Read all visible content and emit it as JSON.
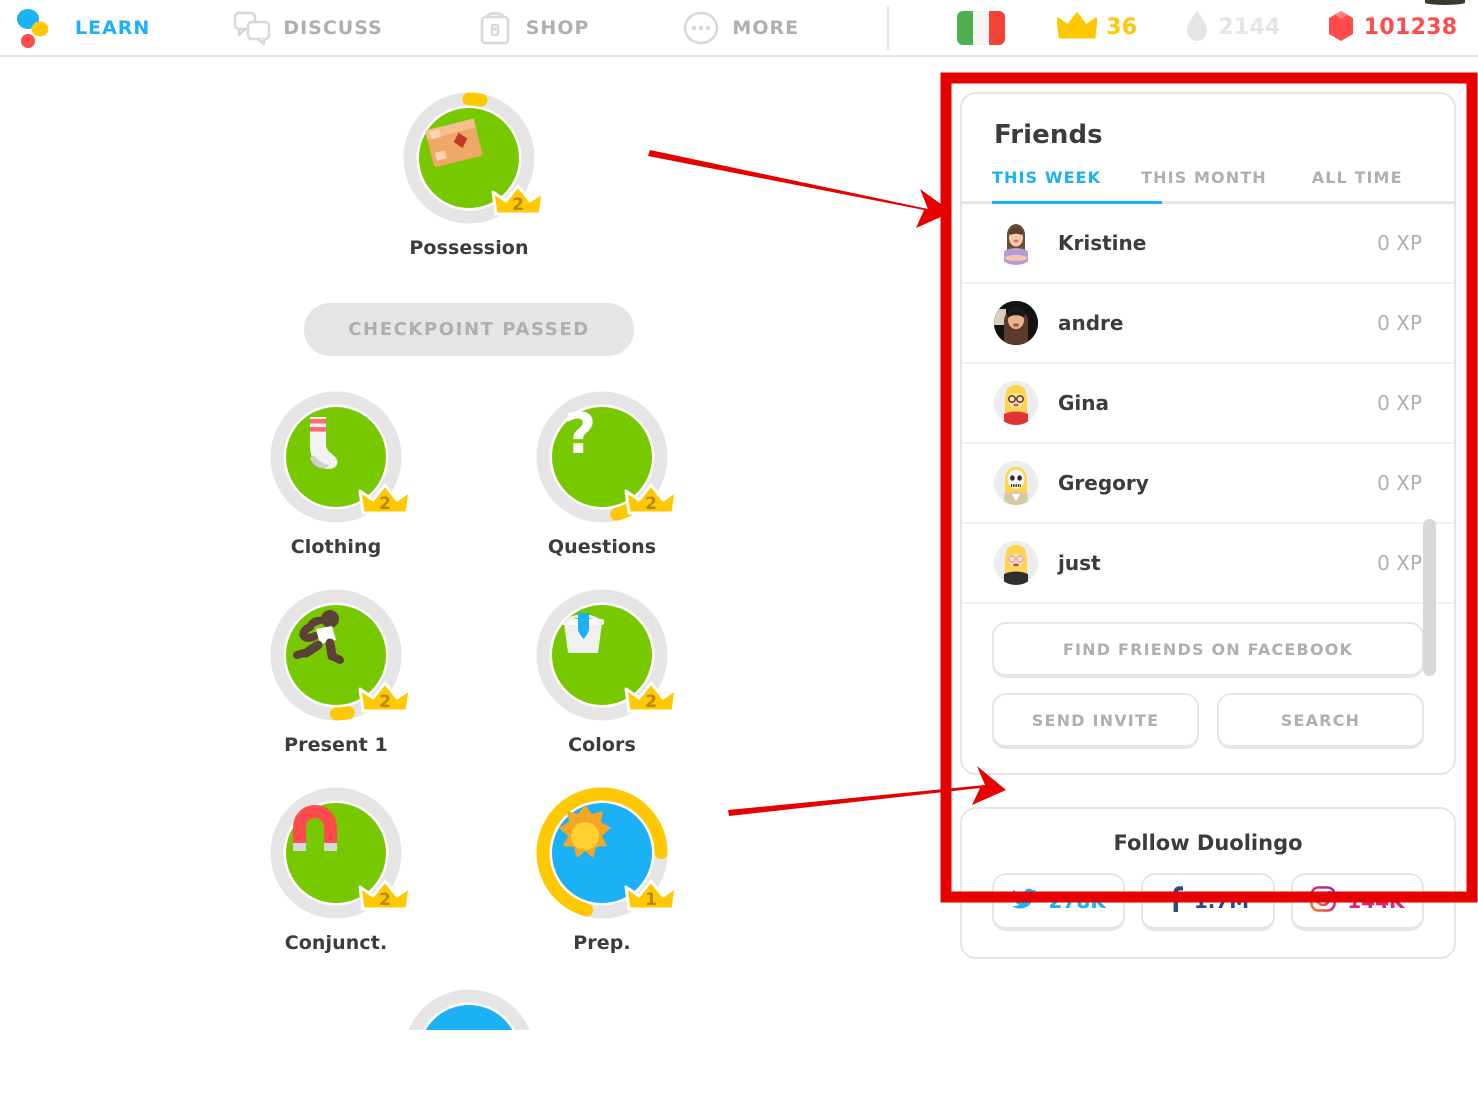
{
  "nav": {
    "items": [
      {
        "label": "LEARN",
        "icon": "duolingo-logo-icon",
        "active": true
      },
      {
        "label": "DISCUSS",
        "icon": "speech-bubbles-icon",
        "active": false
      },
      {
        "label": "SHOP",
        "icon": "shop-bag-icon",
        "active": false
      },
      {
        "label": "MORE",
        "icon": "ellipsis-circle-icon",
        "active": false
      }
    ]
  },
  "stats": {
    "flag": {
      "name": "italian-flag-icon",
      "alt": "Italian"
    },
    "crown": {
      "icon": "crown-icon",
      "value": "36",
      "color": "#ffc800"
    },
    "streak": {
      "icon": "streak-flame-icon",
      "value": "2144",
      "color": "#e5e5e5"
    },
    "gems": {
      "icon": "gem-icon",
      "value": "101238",
      "color": "#ff4b4b"
    }
  },
  "tree": {
    "checkpoint_label": "CHECKPOINT PASSED",
    "rows": [
      [
        {
          "name": "Possession",
          "icon": "package-box-icon",
          "bubble": "green",
          "crown": "2",
          "progress": 0.97
        }
      ],
      [
        {
          "name": "Clothing",
          "icon": "sock-icon",
          "bubble": "green",
          "crown": "2",
          "progress": 0.97
        },
        {
          "name": "Questions",
          "icon": "question-mark-icon",
          "bubble": "green",
          "crown": "2",
          "progress": 0.95
        }
      ],
      [
        {
          "name": "Present 1",
          "icon": "running-person-icon",
          "bubble": "green",
          "crown": "2",
          "progress": 0.96
        },
        {
          "name": "Colors",
          "icon": "paint-bucket-icon",
          "bubble": "green",
          "crown": "2",
          "progress": 1.0
        }
      ],
      [
        {
          "name": "Conjunct.",
          "icon": "magnet-icon",
          "bubble": "green",
          "crown": "2",
          "progress": 1.0
        },
        {
          "name": "Prep.",
          "icon": "sun-icon",
          "bubble": "blue",
          "crown": "1",
          "progress": 0.72
        }
      ]
    ]
  },
  "friends": {
    "title": "Friends",
    "tabs": [
      {
        "label": "THIS WEEK",
        "active": true
      },
      {
        "label": "THIS MONTH",
        "active": false
      },
      {
        "label": "ALL TIME",
        "active": false
      }
    ],
    "rows": [
      {
        "name": "Kristine",
        "xp": "0 XP",
        "avatar": "avatar-kristine"
      },
      {
        "name": "andre",
        "xp": "0 XP",
        "avatar": "avatar-andre"
      },
      {
        "name": "Gina",
        "xp": "0 XP",
        "avatar": "avatar-gina"
      },
      {
        "name": "Gregory",
        "xp": "0 XP",
        "avatar": "avatar-gregory"
      },
      {
        "name": "just",
        "xp": "0 XP",
        "avatar": "avatar-just"
      }
    ],
    "buttons": {
      "facebook": "FIND FRIENDS ON FACEBOOK",
      "invite": "SEND INVITE",
      "search": "SEARCH"
    }
  },
  "follow": {
    "title": "Follow Duolingo",
    "socials": [
      {
        "network": "twitter-icon",
        "count": "278K"
      },
      {
        "network": "facebook-icon",
        "count": "1.7M"
      },
      {
        "network": "instagram-icon",
        "count": "144K"
      }
    ]
  },
  "annotations": {
    "highlight_color": "#e60000",
    "arrows": 2,
    "box_target": "friends-panel"
  }
}
